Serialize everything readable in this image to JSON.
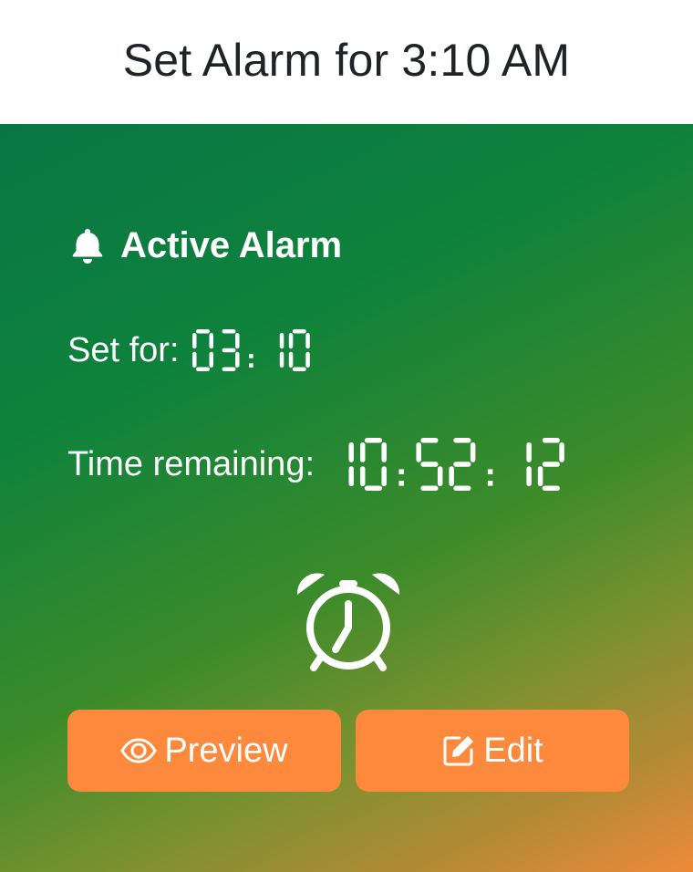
{
  "header": {
    "title": "Set Alarm for 3:10 AM"
  },
  "alarm": {
    "heading": "Active Alarm",
    "set_for_label": "Set for:",
    "set_for_value": "03:10",
    "remaining_label": "Time remaining:",
    "remaining_value": "10:52:12"
  },
  "buttons": {
    "preview_label": "Preview",
    "edit_label": "Edit"
  },
  "icons": {
    "header_bell": "bell-icon",
    "alarm_clock": "alarm-clock-icon",
    "preview": "eye-icon",
    "edit": "edit-icon"
  },
  "colors": {
    "button_bg": "#fd8a3c",
    "gradient_start": "#0a7645",
    "gradient_end": "#ee8a3a",
    "text": "#ffffff"
  }
}
